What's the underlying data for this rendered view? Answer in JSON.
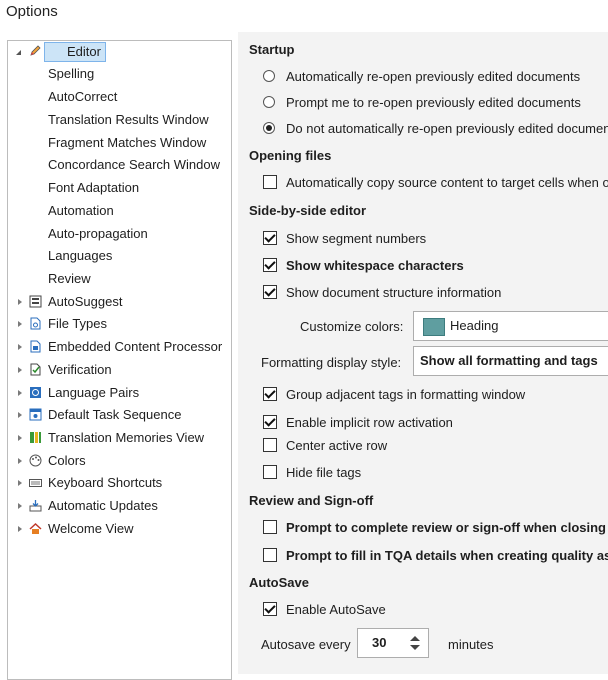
{
  "window": {
    "title": "Options"
  },
  "tree": {
    "root": {
      "label": "Editor",
      "icon": "pencil-icon"
    },
    "children": [
      "Spelling",
      "AutoCorrect",
      "Translation Results Window",
      "Fragment Matches Window",
      "Concordance Search Window",
      "Font Adaptation",
      "Automation",
      "Auto-propagation",
      "Languages",
      "Review"
    ],
    "items": [
      {
        "label": "AutoSuggest",
        "icon": "autosuggest-icon"
      },
      {
        "label": "File Types",
        "icon": "file-types-icon"
      },
      {
        "label": "Embedded Content Processor",
        "icon": "embedded-content-icon"
      },
      {
        "label": "Verification",
        "icon": "verification-icon"
      },
      {
        "label": "Language Pairs",
        "icon": "language-pairs-icon"
      },
      {
        "label": "Default Task Sequence",
        "icon": "task-sequence-icon"
      },
      {
        "label": "Translation Memories View",
        "icon": "translation-memories-icon"
      },
      {
        "label": "Colors",
        "icon": "palette-icon"
      },
      {
        "label": "Keyboard Shortcuts",
        "icon": "keyboard-icon"
      },
      {
        "label": "Automatic Updates",
        "icon": "updates-icon"
      },
      {
        "label": "Welcome View",
        "icon": "home-icon"
      }
    ]
  },
  "startup": {
    "title": "Startup",
    "options": [
      {
        "label": "Automatically re-open previously edited documents",
        "selected": false
      },
      {
        "label": "Prompt me to re-open previously edited documents",
        "selected": false
      },
      {
        "label": "Do not automatically re-open previously edited documents",
        "selected": true
      }
    ]
  },
  "opening": {
    "title": "Opening files",
    "copy_source": {
      "label": "Automatically copy source content to target cells when opening",
      "checked": false
    }
  },
  "sbs": {
    "title": "Side-by-side editor",
    "show_segment_numbers": {
      "label": "Show segment numbers",
      "checked": true
    },
    "show_whitespace": {
      "label": "Show whitespace characters",
      "checked": true
    },
    "show_structure": {
      "label": "Show document structure information",
      "checked": true
    },
    "customize_colors": {
      "label": "Customize colors:",
      "value": "Heading",
      "swatch_color": "#5f9ea0"
    },
    "formatting_style": {
      "label": "Formatting display style:",
      "value": "Show all formatting and tags"
    },
    "group_tags": {
      "label": "Group adjacent tags in formatting window",
      "checked": true
    },
    "implicit_row": {
      "label": "Enable implicit row activation",
      "checked": true
    },
    "center_row": {
      "label": "Center active row",
      "checked": false
    },
    "hide_tags": {
      "label": "Hide file tags",
      "checked": false
    }
  },
  "review": {
    "title": "Review and Sign-off",
    "prompt_complete": {
      "label": "Prompt to complete review or sign-off when closing",
      "checked": false
    },
    "prompt_tqa": {
      "label": "Prompt to fill in TQA details when creating quality assessments",
      "checked": false
    }
  },
  "autosave": {
    "title": "AutoSave",
    "enable": {
      "label": "Enable AutoSave",
      "checked": true
    },
    "every_label": "Autosave every",
    "minutes": "30",
    "unit": "minutes"
  }
}
